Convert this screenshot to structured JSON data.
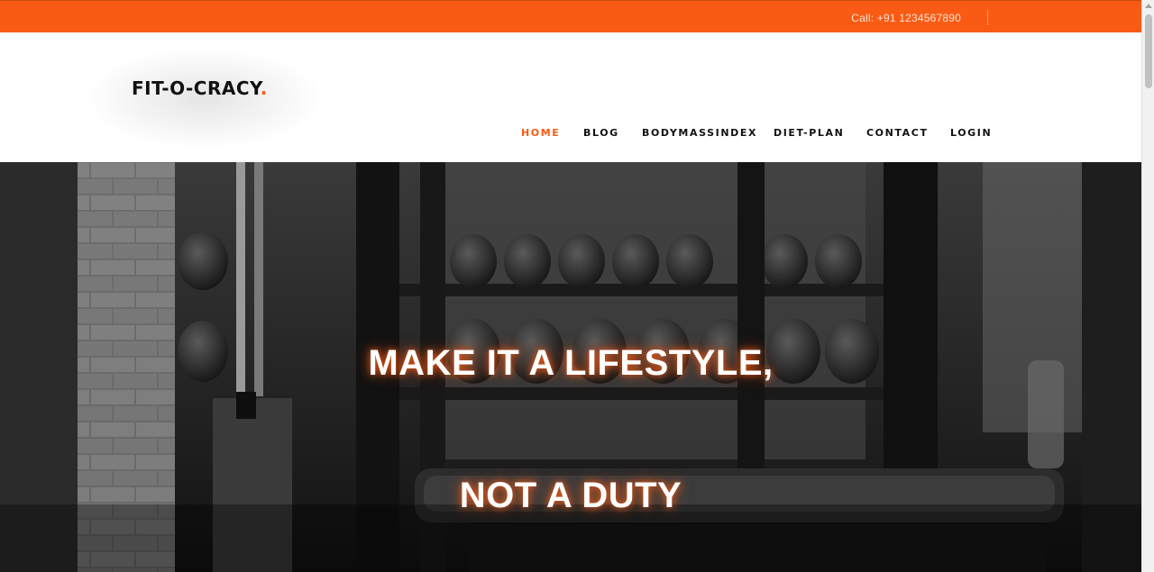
{
  "topbar": {
    "call_text": "Call: +91 1234567890"
  },
  "header": {
    "logo_text": "FIT-O-CRACY",
    "logo_dot": "."
  },
  "nav": {
    "items": [
      "HOME",
      "BLOG",
      "BODYMASSINDEX",
      "DIET-PLAN",
      "CONTACT",
      "LOGIN"
    ],
    "active": "HOME"
  },
  "hero": {
    "line1": "MAKE IT A LIFESTYLE,",
    "line2": "NOT A DUTY"
  },
  "colors": {
    "accent": "#f95b14",
    "text_dark": "#111111",
    "hero_text": "#ffffff"
  },
  "icons": [
    "scroll-up-arrow-icon"
  ]
}
